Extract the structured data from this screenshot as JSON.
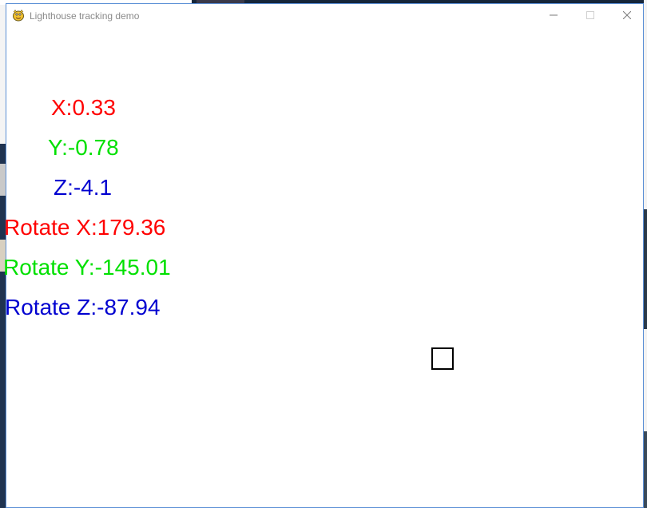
{
  "window": {
    "title": "Lighthouse tracking demo"
  },
  "readouts": {
    "x": {
      "text": "X:0.33",
      "color": "#ff0000"
    },
    "y": {
      "text": "Y:-0.78",
      "color": "#00e000"
    },
    "z": {
      "text": "Z:-4.1",
      "color": "#0000d0"
    },
    "rx": {
      "text": "Rotate X:179.36",
      "color": "#ff0000"
    },
    "ry": {
      "text": "Rotate Y:-145.01",
      "color": "#00e000"
    },
    "rz": {
      "text": "Rotate Z:-87.94",
      "color": "#0000d0"
    }
  },
  "icons": {
    "app": "pygame-snake-icon",
    "minimize": "minimize-icon",
    "maximize": "maximize-icon",
    "close": "close-icon"
  }
}
